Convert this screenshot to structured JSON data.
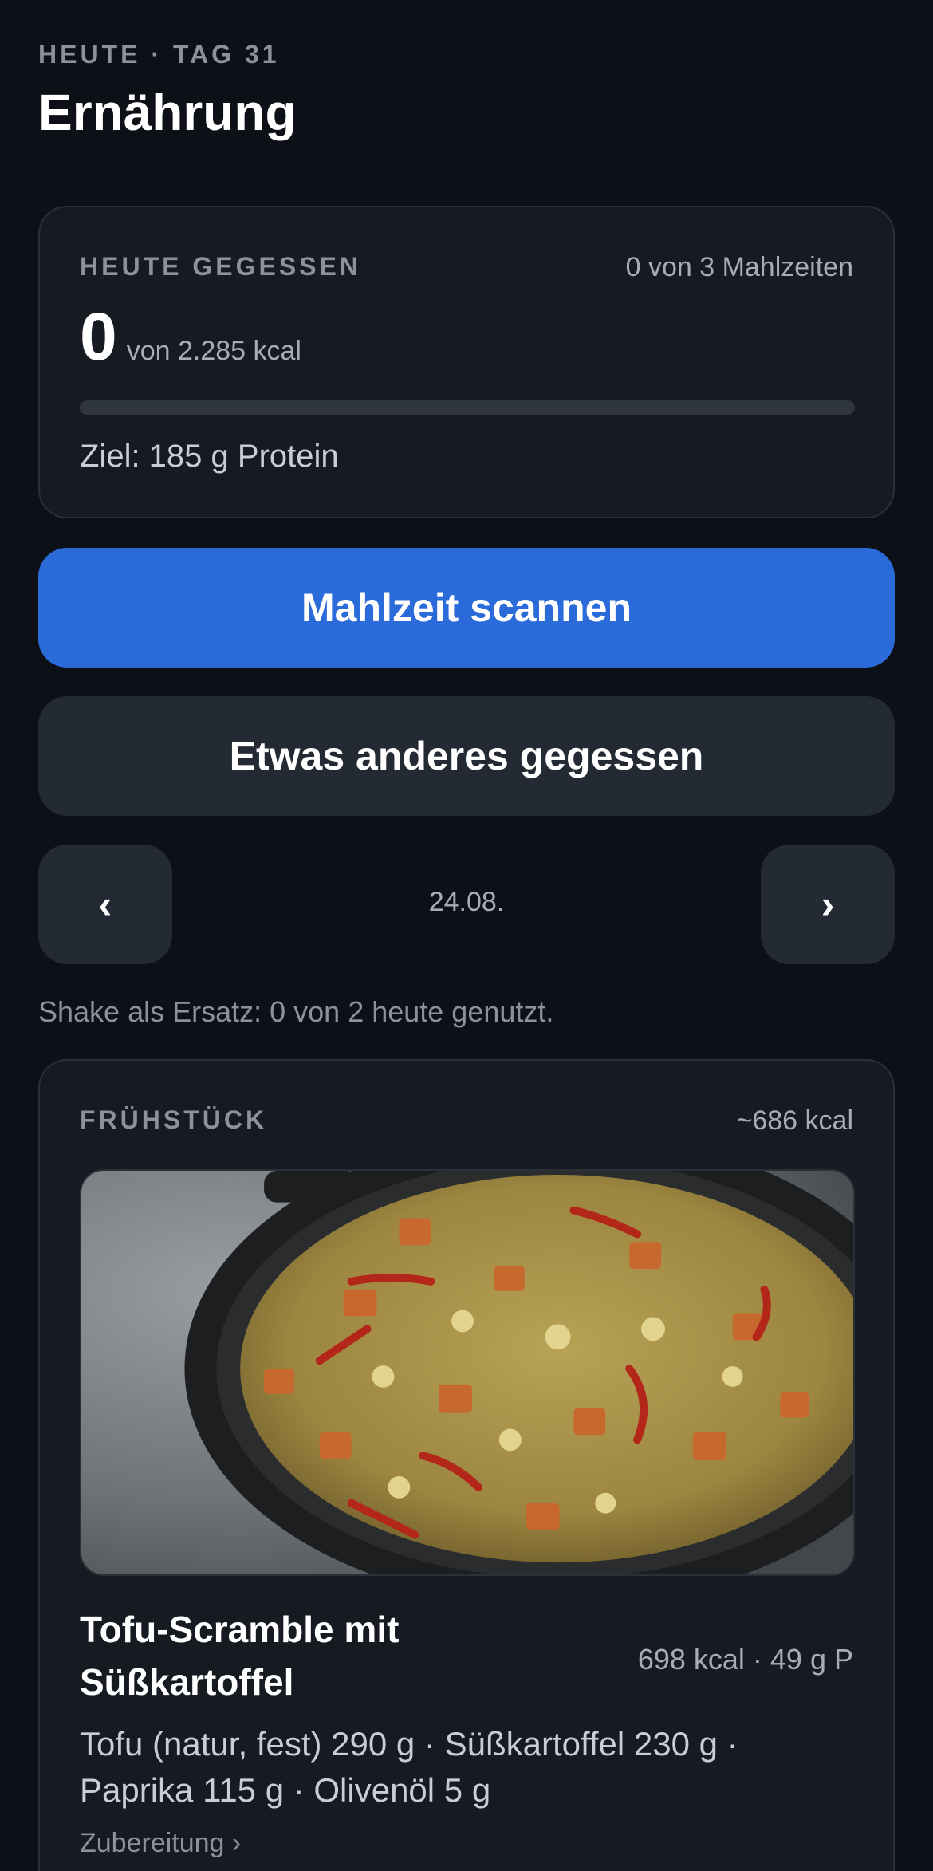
{
  "header": {
    "eyebrow": "HEUTE · TAG 31",
    "title": "Ernährung"
  },
  "summary": {
    "label": "HEUTE GEGESSEN",
    "meals_count": "0 von 3 Mahlzeiten",
    "kcal_value": "0",
    "kcal_target": "von 2.285 kcal",
    "progress_fraction": 0,
    "goal": "Ziel: 185 g Protein"
  },
  "actions": {
    "scan_label": "Mahlzeit scannen",
    "other_label": "Etwas anderes gegessen"
  },
  "date_nav": {
    "prev_icon": "‹",
    "next_icon": "›",
    "date": "24.08."
  },
  "shake_note": "Shake als Ersatz: 0 von 2 heute genutzt.",
  "meal": {
    "label": "FRÜHSTÜCK",
    "kcal": "~686 kcal",
    "dish_name": "Tofu-Scramble mit Süßkartoffel",
    "macros": "698 kcal · 49 g P",
    "ingredients": "Tofu (natur, fest) 290 g · Süßkartoffel 230 g · Paprika 115 g · Olivenöl 5 g",
    "prep_link": "Zubereitung ›"
  },
  "colors": {
    "background": "#0d1117",
    "card": "#161b22",
    "primary": "#2a6bd9",
    "secondary": "#232a33"
  }
}
